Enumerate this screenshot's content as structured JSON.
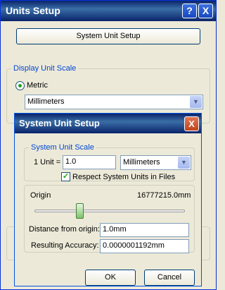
{
  "window": {
    "title": "Units Setup",
    "help_button": "?",
    "close_button": "X"
  },
  "system_unit_setup_button": "System Unit Setup",
  "display_unit_scale": {
    "group_label": "Display Unit Scale",
    "metric_label": "Metric",
    "metric_selected": true,
    "metric_unit": "Millimeters"
  },
  "dialog": {
    "title": "System Unit Setup",
    "close_button": "X",
    "system_unit_scale": {
      "group_label": "System Unit Scale",
      "unit_label": "1 Unit =",
      "unit_value": "1.0",
      "unit_type": "Millimeters",
      "respect_label": "Respect System Units in Files",
      "respect_checked": true
    },
    "origin": {
      "label": "Origin",
      "value": "16777215.0mm",
      "slider_position": 0.3
    },
    "distance_label": "Distance from origin:",
    "distance_value": "1.0mm",
    "accuracy_label": "Resulting Accuracy:",
    "accuracy_value": "0.0000001192mm",
    "ok_label": "OK",
    "cancel_label": "Cancel"
  },
  "colors": {
    "title_bar": "#0a246a",
    "face": "#ece9d8",
    "group_label": "#0046d5",
    "check_green": "#21a121"
  }
}
